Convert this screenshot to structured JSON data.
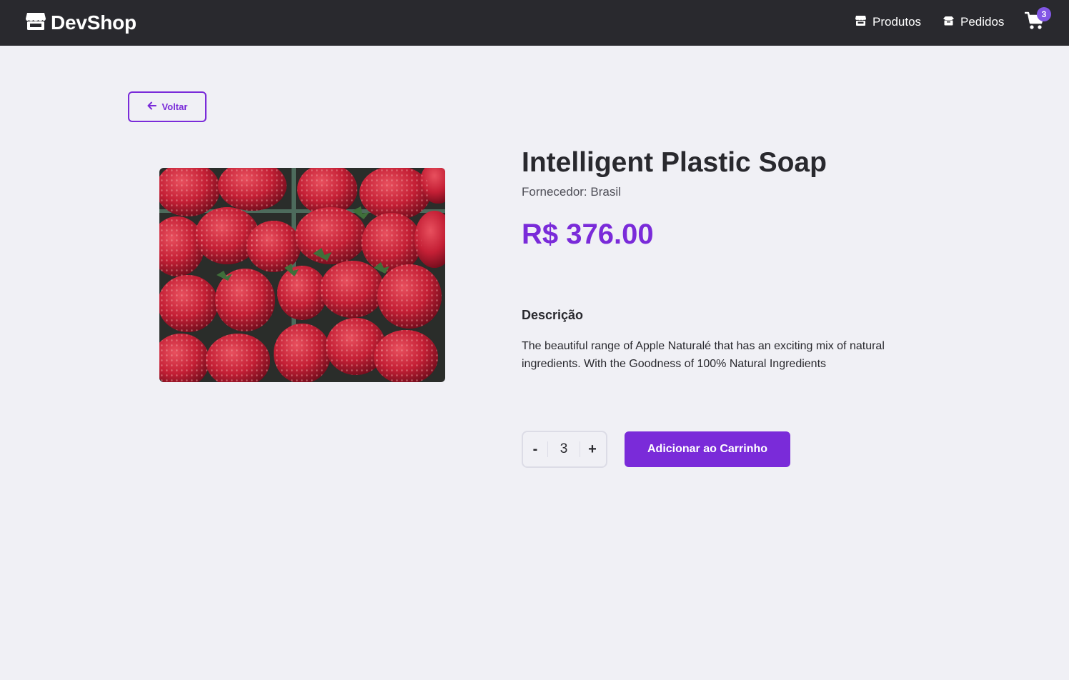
{
  "header": {
    "brand": "DevShop",
    "brand_icon": "store-icon",
    "nav": [
      {
        "label": "Produtos",
        "icon": "store-icon"
      },
      {
        "label": "Pedidos",
        "icon": "box-icon"
      }
    ],
    "cart_icon": "shopping-cart-icon",
    "cart_count": "3"
  },
  "back_button": {
    "label": "Voltar",
    "icon": "arrow-left-icon"
  },
  "product": {
    "image": "strawberries-photo",
    "title": "Intelligent Plastic Soap",
    "supplier": "Fornecedor: Brasil",
    "price": "R$ 376.00",
    "description_heading": "Descrição",
    "description": "The beautiful range of Apple Naturalé that has an exciting mix of natural ingredients. With the Goodness of 100% Natural Ingredients"
  },
  "quantity": {
    "minus": "-",
    "value": "3",
    "plus": "+"
  },
  "add_to_cart": {
    "label": "Adicionar ao Carrinho"
  },
  "colors": {
    "header_bg": "#29292e",
    "page_bg": "#f0f0f5",
    "accent": "#7a2bd9",
    "badge": "#8257e5",
    "text": "#29292e"
  }
}
